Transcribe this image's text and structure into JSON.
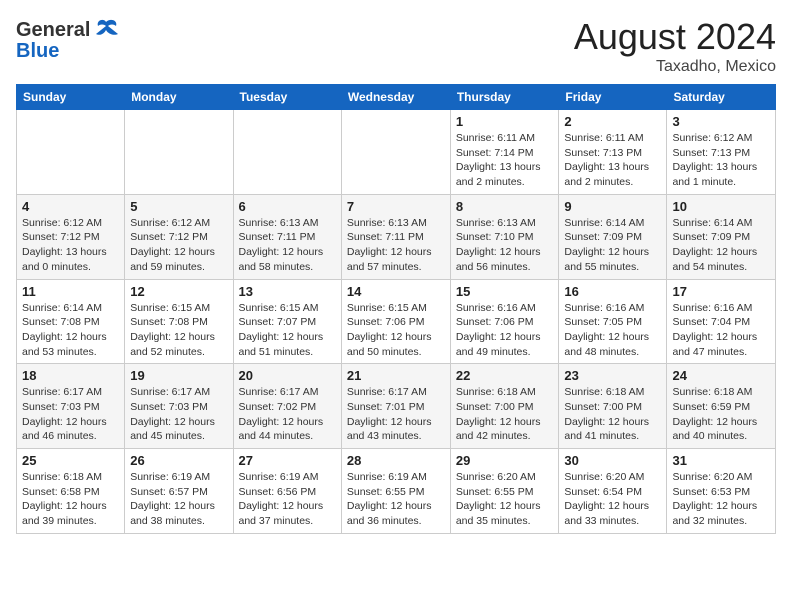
{
  "header": {
    "logo_general": "General",
    "logo_blue": "Blue",
    "month_year": "August 2024",
    "location": "Taxadho, Mexico"
  },
  "weekdays": [
    "Sunday",
    "Monday",
    "Tuesday",
    "Wednesday",
    "Thursday",
    "Friday",
    "Saturday"
  ],
  "weeks": [
    [
      {
        "day": "",
        "info": ""
      },
      {
        "day": "",
        "info": ""
      },
      {
        "day": "",
        "info": ""
      },
      {
        "day": "",
        "info": ""
      },
      {
        "day": "1",
        "info": "Sunrise: 6:11 AM\nSunset: 7:14 PM\nDaylight: 13 hours\nand 2 minutes."
      },
      {
        "day": "2",
        "info": "Sunrise: 6:11 AM\nSunset: 7:13 PM\nDaylight: 13 hours\nand 2 minutes."
      },
      {
        "day": "3",
        "info": "Sunrise: 6:12 AM\nSunset: 7:13 PM\nDaylight: 13 hours\nand 1 minute."
      }
    ],
    [
      {
        "day": "4",
        "info": "Sunrise: 6:12 AM\nSunset: 7:12 PM\nDaylight: 13 hours\nand 0 minutes."
      },
      {
        "day": "5",
        "info": "Sunrise: 6:12 AM\nSunset: 7:12 PM\nDaylight: 12 hours\nand 59 minutes."
      },
      {
        "day": "6",
        "info": "Sunrise: 6:13 AM\nSunset: 7:11 PM\nDaylight: 12 hours\nand 58 minutes."
      },
      {
        "day": "7",
        "info": "Sunrise: 6:13 AM\nSunset: 7:11 PM\nDaylight: 12 hours\nand 57 minutes."
      },
      {
        "day": "8",
        "info": "Sunrise: 6:13 AM\nSunset: 7:10 PM\nDaylight: 12 hours\nand 56 minutes."
      },
      {
        "day": "9",
        "info": "Sunrise: 6:14 AM\nSunset: 7:09 PM\nDaylight: 12 hours\nand 55 minutes."
      },
      {
        "day": "10",
        "info": "Sunrise: 6:14 AM\nSunset: 7:09 PM\nDaylight: 12 hours\nand 54 minutes."
      }
    ],
    [
      {
        "day": "11",
        "info": "Sunrise: 6:14 AM\nSunset: 7:08 PM\nDaylight: 12 hours\nand 53 minutes."
      },
      {
        "day": "12",
        "info": "Sunrise: 6:15 AM\nSunset: 7:08 PM\nDaylight: 12 hours\nand 52 minutes."
      },
      {
        "day": "13",
        "info": "Sunrise: 6:15 AM\nSunset: 7:07 PM\nDaylight: 12 hours\nand 51 minutes."
      },
      {
        "day": "14",
        "info": "Sunrise: 6:15 AM\nSunset: 7:06 PM\nDaylight: 12 hours\nand 50 minutes."
      },
      {
        "day": "15",
        "info": "Sunrise: 6:16 AM\nSunset: 7:06 PM\nDaylight: 12 hours\nand 49 minutes."
      },
      {
        "day": "16",
        "info": "Sunrise: 6:16 AM\nSunset: 7:05 PM\nDaylight: 12 hours\nand 48 minutes."
      },
      {
        "day": "17",
        "info": "Sunrise: 6:16 AM\nSunset: 7:04 PM\nDaylight: 12 hours\nand 47 minutes."
      }
    ],
    [
      {
        "day": "18",
        "info": "Sunrise: 6:17 AM\nSunset: 7:03 PM\nDaylight: 12 hours\nand 46 minutes."
      },
      {
        "day": "19",
        "info": "Sunrise: 6:17 AM\nSunset: 7:03 PM\nDaylight: 12 hours\nand 45 minutes."
      },
      {
        "day": "20",
        "info": "Sunrise: 6:17 AM\nSunset: 7:02 PM\nDaylight: 12 hours\nand 44 minutes."
      },
      {
        "day": "21",
        "info": "Sunrise: 6:17 AM\nSunset: 7:01 PM\nDaylight: 12 hours\nand 43 minutes."
      },
      {
        "day": "22",
        "info": "Sunrise: 6:18 AM\nSunset: 7:00 PM\nDaylight: 12 hours\nand 42 minutes."
      },
      {
        "day": "23",
        "info": "Sunrise: 6:18 AM\nSunset: 7:00 PM\nDaylight: 12 hours\nand 41 minutes."
      },
      {
        "day": "24",
        "info": "Sunrise: 6:18 AM\nSunset: 6:59 PM\nDaylight: 12 hours\nand 40 minutes."
      }
    ],
    [
      {
        "day": "25",
        "info": "Sunrise: 6:18 AM\nSunset: 6:58 PM\nDaylight: 12 hours\nand 39 minutes."
      },
      {
        "day": "26",
        "info": "Sunrise: 6:19 AM\nSunset: 6:57 PM\nDaylight: 12 hours\nand 38 minutes."
      },
      {
        "day": "27",
        "info": "Sunrise: 6:19 AM\nSunset: 6:56 PM\nDaylight: 12 hours\nand 37 minutes."
      },
      {
        "day": "28",
        "info": "Sunrise: 6:19 AM\nSunset: 6:55 PM\nDaylight: 12 hours\nand 36 minutes."
      },
      {
        "day": "29",
        "info": "Sunrise: 6:20 AM\nSunset: 6:55 PM\nDaylight: 12 hours\nand 35 minutes."
      },
      {
        "day": "30",
        "info": "Sunrise: 6:20 AM\nSunset: 6:54 PM\nDaylight: 12 hours\nand 33 minutes."
      },
      {
        "day": "31",
        "info": "Sunrise: 6:20 AM\nSunset: 6:53 PM\nDaylight: 12 hours\nand 32 minutes."
      }
    ]
  ]
}
